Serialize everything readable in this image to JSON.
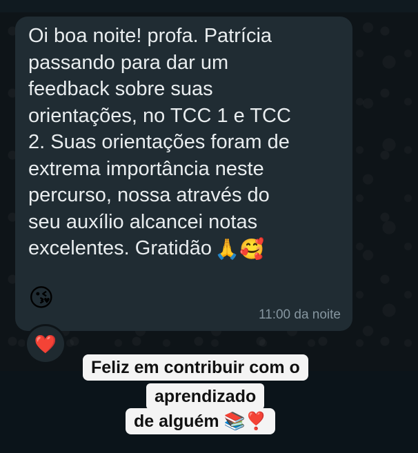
{
  "message": {
    "text": "Oi boa noite! profa. Patrícia\npassando para dar um\nfeedback sobre suas\norientações, no TCC 1 e TCC\n2. Suas orientações foram de\nextrema importância neste\npercurso, nossa através do\nseu auxílio alcancei notas\nexcelentes. Gratidão",
    "inline_emojis": "🙏🥰",
    "emoji_line": "😘",
    "timestamp": "11:00 da noite"
  },
  "reaction": {
    "emoji": "❤️"
  },
  "caption": {
    "line1": "Feliz em contribuir com o",
    "line2": "aprendizado",
    "line3": "de alguém 📚❣️"
  },
  "colors": {
    "bubble": "#202c33",
    "background": "#0e1418",
    "message_text": "#e9edef",
    "timestamp_text": "#8696a0",
    "caption_background": "#f4f4f4"
  }
}
